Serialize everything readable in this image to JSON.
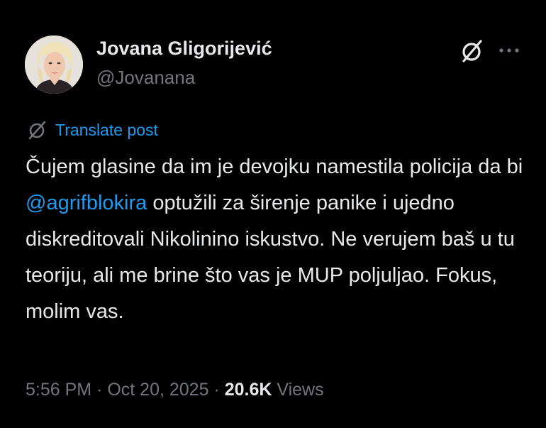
{
  "author": {
    "display_name": "Jovana Gligorijević",
    "handle": "@Jovanana"
  },
  "icons": {
    "grok": "grok-icon",
    "more": "more-horizontal-icon",
    "translate": "grok-icon"
  },
  "translate": {
    "label": "Translate post"
  },
  "post": {
    "text_before_mention": "Čujem glasine da im je devojku namestila policija da bi ",
    "mention": "@agrifblokira",
    "text_after_mention": " optužili za širenje panike i ujedno diskreditovali Nikolinino iskustvo. Ne verujem baš u tu teoriju, ali me brine što vas je MUP poljuljao. Fokus, molim vas."
  },
  "meta": {
    "time": "5:56 PM",
    "separator": " · ",
    "date": "Oct 20, 2025",
    "views_count": "20.6K",
    "views_label": "Views"
  },
  "colors": {
    "background": "#000000",
    "text_primary": "#e7e9ea",
    "text_secondary": "#71767b",
    "link": "#1d9bf0"
  }
}
